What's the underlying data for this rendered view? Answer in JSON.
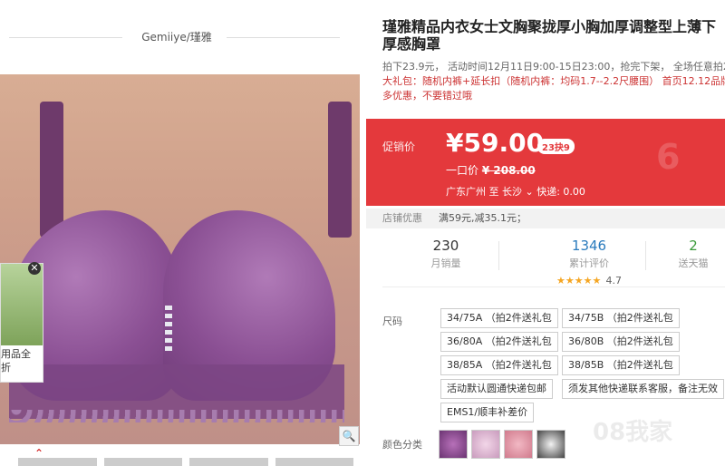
{
  "brand": {
    "name": "Gemiiye/瑾雅"
  },
  "product": {
    "title": "瑾雅精品内衣女士文胸聚拢厚小胸加厚调整型上薄下厚感胸罩",
    "promo_line1": "拍下23.9元， 活动时间12月11日9:00-15日23:00，抢完下架， 全场任意拍2",
    "promo_line2": "大礼包：随机内裤+延长扣（随机内裤：均码1.7--2.2尺腰围） 首页12.12品牌",
    "promo_line3": "多优惠，不要错过哦"
  },
  "price": {
    "label": "促销价",
    "current": "¥59.00",
    "tag": "23抉9",
    "original_label": "一口价",
    "original_price": "¥ 208.00",
    "ship_from": "广东广州",
    "ship_to_word": "至",
    "ship_to": "长沙",
    "express": "快递: 0.00"
  },
  "coupon": {
    "label": "店铺优惠",
    "value": "满59元,减35.1元；"
  },
  "stats": {
    "sales_num": "230",
    "sales_label": "月销量",
    "reviews_num": "1346",
    "reviews_label": "累计评价",
    "rating_stars": "★★★★★",
    "rating_value": "4.7",
    "returns_num": "2",
    "returns_label": "送天猫"
  },
  "options": {
    "size_label": "尺码",
    "sizes": [
      "34/75A （拍2件送礼包",
      "34/75B （拍2件送礼包",
      "36/80A （拍2件送礼包",
      "36/80B （拍2件送礼包",
      "38/85A （拍2件送礼包",
      "38/85B （拍2件送礼包",
      "活动默认圆通快递包邮",
      "须发其他快递联系客服，备注无效",
      "EMS1/顺丰补差价"
    ],
    "color_label": "颜色分类"
  },
  "side_ad": {
    "text_line1": "用品全",
    "text_line2": "折"
  },
  "watermark": "08我家"
}
